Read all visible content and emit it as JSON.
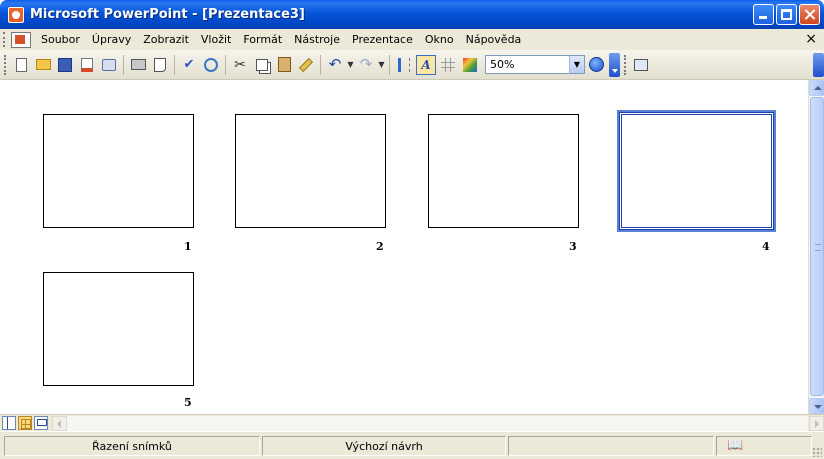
{
  "window": {
    "title": "Microsoft PowerPoint - [Prezentace3]"
  },
  "menubar": {
    "items": [
      "Soubor",
      "Úpravy",
      "Zobrazit",
      "Vložit",
      "Formát",
      "Nástroje",
      "Prezentace",
      "Okno",
      "Nápověda"
    ],
    "close_glyph": "×"
  },
  "toolbar": {
    "icons": [
      "new-icon",
      "open-icon",
      "save-icon",
      "permission-icon",
      "research-icon",
      "print-icon",
      "print-preview-icon",
      "spelling-icon",
      "research-find-icon",
      "cut-icon",
      "copy-icon",
      "paste-icon",
      "format-painter-icon",
      "undo-icon",
      "redo-icon",
      "expand-all-icon",
      "show-formatting-icon",
      "grid-icon",
      "color-grayscale-icon",
      "help-icon",
      "slideshow-icon"
    ],
    "zoom_value": "50%"
  },
  "slides": [
    {
      "number": "1",
      "selected": false
    },
    {
      "number": "2",
      "selected": false
    },
    {
      "number": "3",
      "selected": false
    },
    {
      "number": "4",
      "selected": true
    },
    {
      "number": "5",
      "selected": false
    }
  ],
  "statusbar": {
    "view_label": "Řazení snímků",
    "design_label": "Výchozí návrh",
    "spellcheck_icon": "spellcheck-status-icon"
  },
  "colors": {
    "titlebar": "#0054e3",
    "selection": "#1c43ac",
    "chrome": "#ece9d8"
  }
}
